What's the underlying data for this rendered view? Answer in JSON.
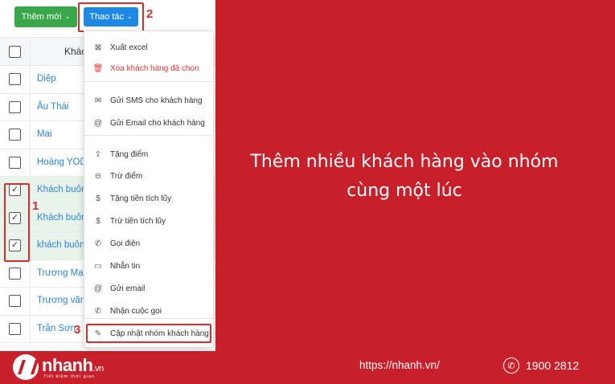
{
  "toolbar": {
    "add_label": "Thêm mới",
    "action_label": "Thao tác",
    "caret": "⌄"
  },
  "callouts": {
    "one": "1",
    "two": "2",
    "three": "3"
  },
  "table": {
    "header_name": "Khác",
    "rows": [
      {
        "name": "Diệp",
        "checked": false,
        "check": ""
      },
      {
        "name": "Âu Thái",
        "checked": false,
        "check": ""
      },
      {
        "name": "Mai",
        "checked": false,
        "check": ""
      },
      {
        "name": "Hoàng YODY",
        "checked": false,
        "check": ""
      },
      {
        "name": "Khách buôn",
        "checked": true,
        "check": "✓"
      },
      {
        "name": "Khách buôn",
        "checked": true,
        "check": "✓"
      },
      {
        "name": "khách buôn",
        "checked": true,
        "check": "✓"
      },
      {
        "name": "Trương Mạnh",
        "checked": false,
        "check": ""
      },
      {
        "name": "Trương văn l",
        "checked": false,
        "check": ""
      },
      {
        "name": "Trần Sơn",
        "checked": false,
        "check": ""
      }
    ]
  },
  "menu": {
    "items": [
      {
        "label": "Xuất excel",
        "icon": "excel-icon",
        "glyph": "⊠"
      },
      {
        "label": "Xóa khách hàng đã chọn",
        "icon": "trash-icon",
        "glyph": "🗑"
      },
      {
        "label": "Gửi SMS cho khách hàng",
        "icon": "mail-icon",
        "glyph": "✉"
      },
      {
        "label": "Gửi Email cho khách hàng",
        "icon": "at-icon",
        "glyph": "@"
      },
      {
        "label": "Tặng điểm",
        "icon": "gift-icon",
        "glyph": "⇪"
      },
      {
        "label": "Trừ điểm",
        "icon": "minus-points-icon",
        "glyph": "⊖"
      },
      {
        "label": "Tặng tiền tích lũy",
        "icon": "dollar-icon",
        "glyph": "$"
      },
      {
        "label": "Trừ tiền tích lũy",
        "icon": "dollar-minus-icon",
        "glyph": "$"
      },
      {
        "label": "Gọi điện",
        "icon": "phone-icon",
        "glyph": "✆"
      },
      {
        "label": "Nhắn tin",
        "icon": "message-icon",
        "glyph": "▭"
      },
      {
        "label": "Gửi email",
        "icon": "email-icon",
        "glyph": "@"
      },
      {
        "label": "Nhận cuộc gọi",
        "icon": "incoming-call-icon",
        "glyph": "✆"
      },
      {
        "label": "Cập nhật nhóm khách hàng",
        "icon": "edit-icon",
        "glyph": "✎"
      }
    ]
  },
  "headline": {
    "line1": "Thêm nhiều khách hàng vào nhóm",
    "line2": "cùng một lúc"
  },
  "footer": {
    "logo_word": "nhanh",
    "logo_suffix": ".vn",
    "logo_tagline": "Tiết kiệm thời gian",
    "site": "https://nhanh.vn/",
    "phone": "1900 2812",
    "phone_glyph": "✆"
  },
  "colors": {
    "brand_red": "#c8202a",
    "add_green": "#3aa84a",
    "action_blue": "#1e88e5",
    "highlight_red": "#d32f2f"
  }
}
